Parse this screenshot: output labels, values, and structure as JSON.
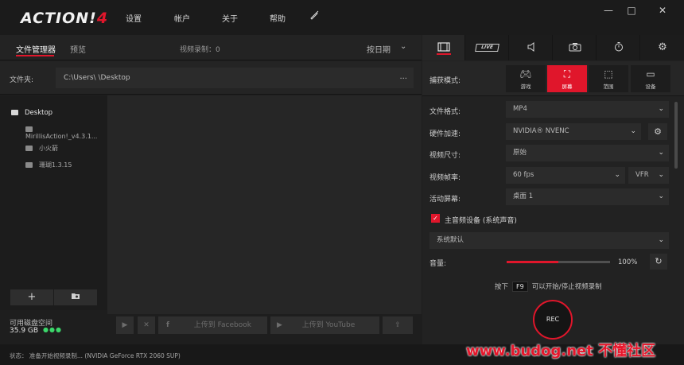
{
  "app": {
    "logo_text": "ACTION!",
    "logo_version": "4"
  },
  "menu": {
    "settings": "设置",
    "account": "帐户",
    "about": "关于",
    "help": "帮助"
  },
  "window_controls": {
    "minimize": "—",
    "maximize": "□",
    "close": "✕"
  },
  "file_manager": {
    "tab_files": "文件管理器",
    "tab_preview": "预览",
    "record_count": "视频录制：0",
    "sort_label": "按日期",
    "folder_label": "文件夹:",
    "folder_path": "C:\\Users\\          \\Desktop",
    "folder_more": "...",
    "tree": [
      {
        "label": "Desktop"
      },
      {
        "label": "MirillisAction!_v4.3.1..."
      },
      {
        "label": "小火箭"
      },
      {
        "label": "珊瑚1.3.15"
      }
    ],
    "add_button": "+",
    "disk_label": "可用磁盘空间",
    "disk_value": "35.9 GB",
    "disk_dots": "●●●"
  },
  "action_bar": {
    "upload_facebook": "上传到 Facebook",
    "upload_youtube": "上传到 YouTube"
  },
  "status": {
    "text": "状态：    准备开始视频录制...   (NVIDIA GeForce RTX 2060 SUP)"
  },
  "right_panel": {
    "tabs": [
      {
        "name": "video"
      },
      {
        "name": "live",
        "label": "LIVE"
      },
      {
        "name": "audio"
      },
      {
        "name": "screenshot"
      },
      {
        "name": "timer"
      },
      {
        "name": "settings"
      }
    ],
    "capture_mode_label": "捕获模式:",
    "capture_modes": [
      {
        "label": "游戏"
      },
      {
        "label": "屏幕"
      },
      {
        "label": "范围"
      },
      {
        "label": "设备"
      }
    ],
    "settings": {
      "file_format_label": "文件格式:",
      "file_format_value": "MP4",
      "hw_accel_label": "硬件加速:",
      "hw_accel_value": "NVIDIA® NVENC",
      "video_size_label": "视频尺寸:",
      "video_size_value": "原始",
      "framerate_label": "视频帧率:",
      "framerate_value": "60 fps",
      "framerate_mode": "VFR",
      "active_screen_label": "活动屏幕:",
      "active_screen_value": "桌面 1"
    },
    "audio": {
      "main_device_label": "主音频设备 (系统声音)",
      "device_value": "系统默认",
      "volume_label": "音量:",
      "volume_value": "100%",
      "volume_level": 0.5
    },
    "hotkey": {
      "prefix": "按下",
      "key": "F9",
      "suffix": "可以开始/停止视频录制"
    },
    "rec_label": "REC"
  },
  "watermark": "www.budog.net 不懂社区",
  "colors": {
    "accent": "#e0162b",
    "background": "#1e1e1e",
    "panel": "#222222",
    "disk_dots": "#3bd66a"
  }
}
